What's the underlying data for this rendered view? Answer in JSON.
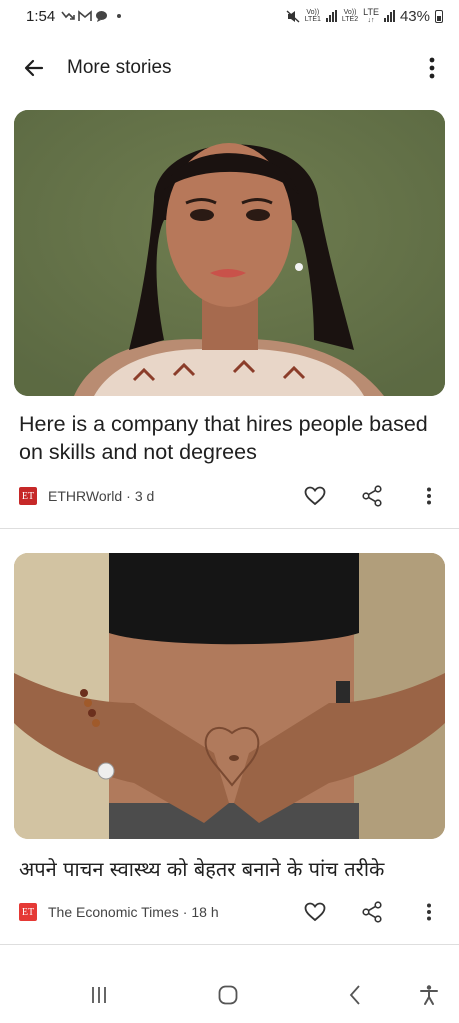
{
  "status_bar": {
    "time": "1:54",
    "network_label_1_top": "Vo))",
    "network_label_1_bottom": "LTE1",
    "network_label_2_top": "Vo))",
    "network_label_2_bottom": "LTE2",
    "network_label_3_top": "LTE",
    "battery_percent": "43%"
  },
  "app_bar": {
    "title": "More stories"
  },
  "stories": [
    {
      "headline": "Here is a company that hires people based on skills and not degrees",
      "source": "ETHRWorld",
      "separator": "·",
      "age": "3 d",
      "logo_text": "ET",
      "logo_color": "#c62828"
    },
    {
      "headline": "अपने पाचन स्वास्थ्य को बेहतर बनाने के पांच तरीके",
      "source": "The Economic Times",
      "separator": "·",
      "age": "18 h",
      "logo_text": "ET",
      "logo_color": "#e53935"
    }
  ],
  "icons": {
    "back": "arrow-left-icon",
    "overflow": "more-vert-icon",
    "like": "heart-icon",
    "share": "share-icon",
    "more": "more-vert-icon"
  }
}
